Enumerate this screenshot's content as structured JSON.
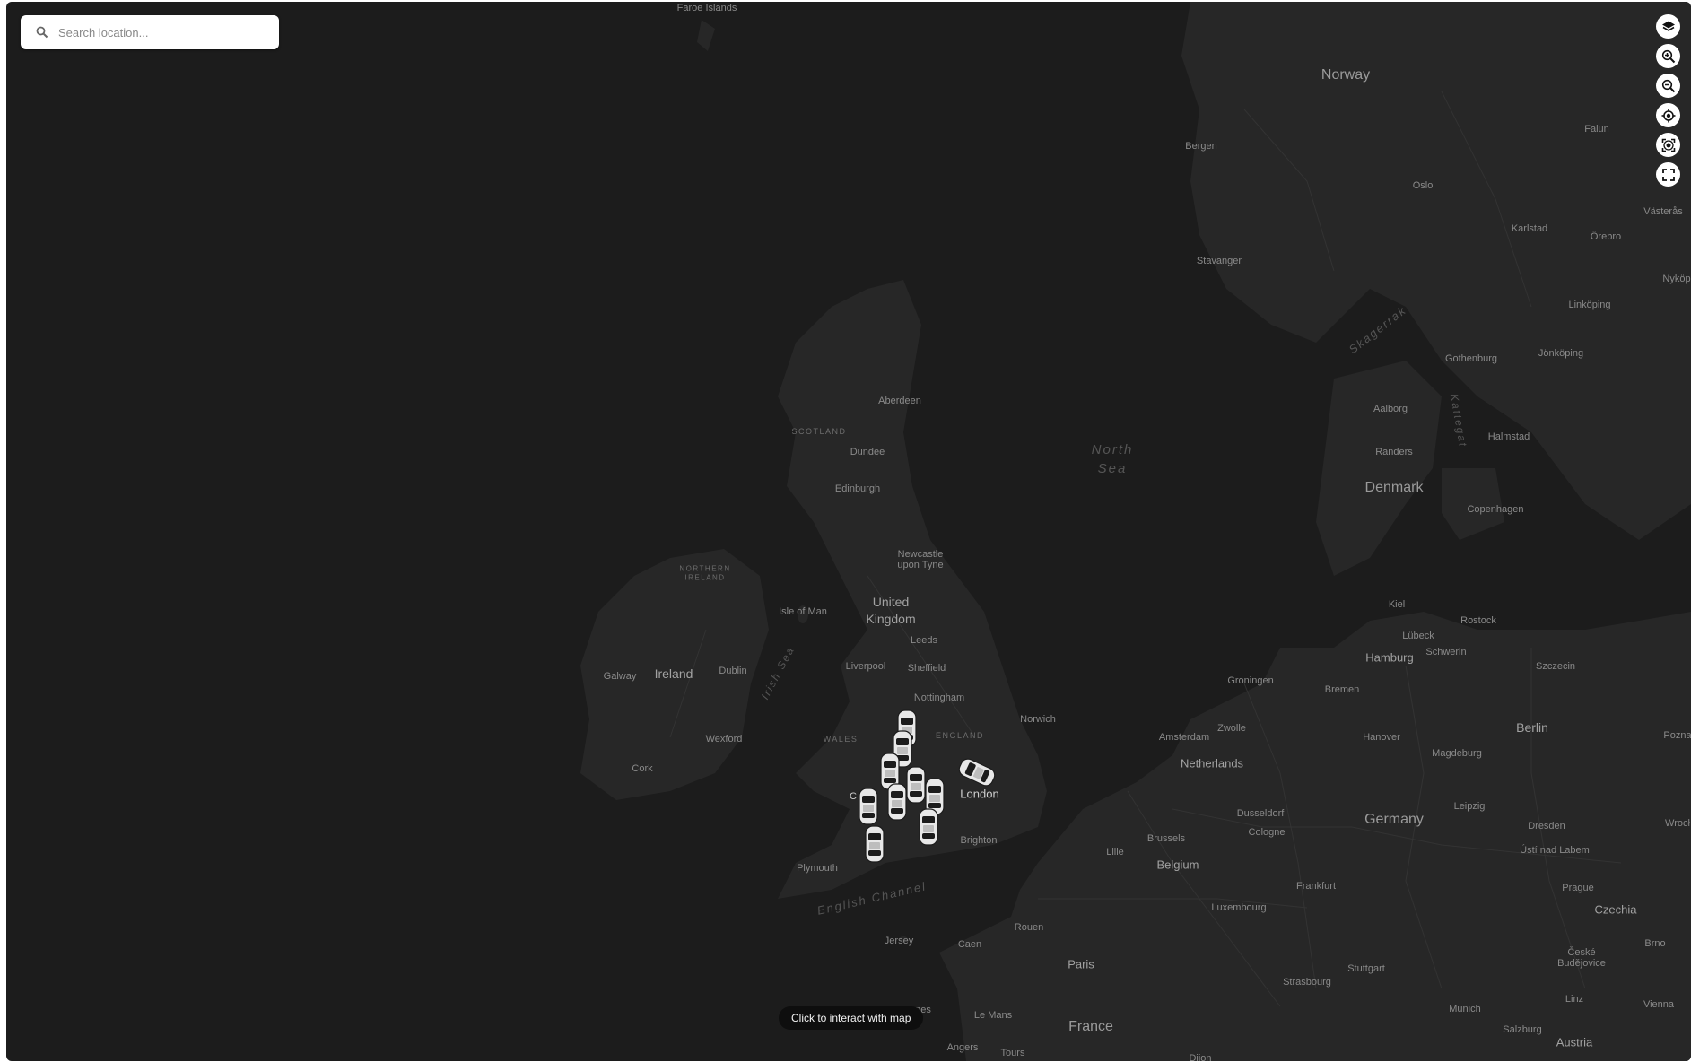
{
  "search": {
    "placeholder": "Search location...",
    "value": ""
  },
  "controls": [
    {
      "name": "layers-button",
      "icon": "layers-icon"
    },
    {
      "name": "zoom-in-button",
      "icon": "zoom-in-icon"
    },
    {
      "name": "zoom-out-button",
      "icon": "zoom-out-icon"
    },
    {
      "name": "my-location-button",
      "icon": "locate-icon"
    },
    {
      "name": "fit-bounds-button",
      "icon": "focus-icon"
    },
    {
      "name": "fullscreen-button",
      "icon": "fullscreen-icon"
    }
  ],
  "hint": "Click to interact with map",
  "labels": {
    "faroe": "Faroe Islands",
    "norway": "Norway",
    "bergen": "Bergen",
    "oslo": "Oslo",
    "falun": "Falun",
    "vasteras": "Västerås",
    "karlstad": "Karlstad",
    "orebro": "Örebro",
    "stavanger": "Stavanger",
    "nykoping": "Nyköp",
    "linkoping": "Linköping",
    "skagerrak": "Skagerrak",
    "gothenburg": "Gothenburg",
    "jonkoping": "Jönköping",
    "kattegat": "Kattegat",
    "aalborg": "Aalborg",
    "halmstad": "Halmstad",
    "randers": "Randers",
    "denmark": "Denmark",
    "copenhagen": "Copenhagen",
    "north_sea_1": "North",
    "north_sea_2": "Sea",
    "aberdeen": "Aberdeen",
    "scotland": "SCOTLAND",
    "dundee": "Dundee",
    "edinburgh": "Edinburgh",
    "newcastle_1": "Newcastle",
    "newcastle_2": "upon Tyne",
    "northern_ireland_1": "NORTHERN",
    "northern_ireland_2": "IRELAND",
    "isle_of_man": "Isle of Man",
    "uk_1": "United",
    "uk_2": "Kingdom",
    "leeds": "Leeds",
    "irish_sea": "Irish Sea",
    "galway": "Galway",
    "ireland": "Ireland",
    "dublin": "Dublin",
    "liverpool": "Liverpool",
    "sheffield": "Sheffield",
    "nottingham": "Nottingham",
    "norwich": "Norwich",
    "wales": "WALES",
    "england": "ENGLAND",
    "wexford": "Wexford",
    "cork": "Cork",
    "london": "London",
    "brighton": "Brighton",
    "plymouth": "Plymouth",
    "english_channel": "English Channel",
    "jersey": "Jersey",
    "caen": "Caen",
    "rouen": "Rouen",
    "paris": "Paris",
    "nes": "nes",
    "le_mans": "Le Mans",
    "angers": "Angers",
    "tours": "Tours",
    "france": "France",
    "kiel": "Kiel",
    "lubeck": "Lübeck",
    "rostock": "Rostock",
    "hamburg": "Hamburg",
    "schwerin": "Schwerin",
    "szczecin": "Szczecin",
    "groningen": "Groningen",
    "bremen": "Bremen",
    "zwolle": "Zwolle",
    "amsterdam": "Amsterdam",
    "hanover": "Hanover",
    "berlin": "Berlin",
    "poznan": "Pozna",
    "netherlands": "Netherlands",
    "magdeburg": "Magdeburg",
    "dusseldorf": "Dusseldorf",
    "leipzig": "Leipzig",
    "brussels": "Brussels",
    "cologne": "Cologne",
    "germany": "Germany",
    "dresden": "Dresden",
    "wroclaw": "Wrocł",
    "lille": "Lille",
    "belgium": "Belgium",
    "usti": "Ústí nad Labem",
    "frankfurt": "Frankfurt",
    "prague": "Prague",
    "luxembourg": "Luxembourg",
    "czechia": "Czechia",
    "stuttgart": "Stuttgart",
    "strasbourg": "Strasbourg",
    "ceske_1": "České",
    "ceske_2": "Budějovice",
    "brno": "Brno",
    "munich": "Munich",
    "linz": "Linz",
    "vienna": "Vienna",
    "salzburg": "Salzburg",
    "austria": "Austria",
    "dijon": "Dijon",
    "car_c": "C"
  },
  "colors": {
    "water": "#1c1c1c",
    "land": "#272727",
    "borders": "#3a3a3a",
    "vehicle": "#e8e8e8"
  }
}
